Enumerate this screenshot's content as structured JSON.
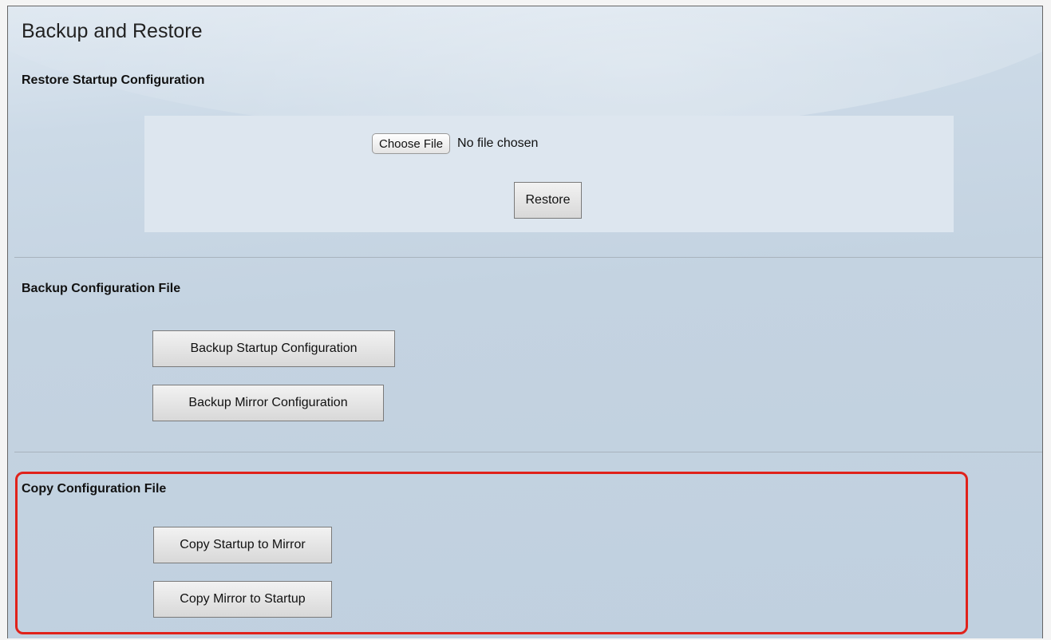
{
  "page": {
    "title": "Backup and Restore"
  },
  "restore": {
    "heading": "Restore Startup Configuration",
    "choose_file_label": "Choose File",
    "file_status": "No file chosen",
    "restore_label": "Restore"
  },
  "backup": {
    "heading": "Backup Configuration File",
    "startup_label": "Backup Startup Configuration",
    "mirror_label": "Backup Mirror Configuration"
  },
  "copy": {
    "heading": "Copy Configuration File",
    "startup_to_mirror_label": "Copy Startup to Mirror",
    "mirror_to_startup_label": "Copy Mirror to Startup"
  },
  "colors": {
    "highlight": "#e0221b",
    "background": "#c4d3e1",
    "panel": "#dde6ef"
  }
}
